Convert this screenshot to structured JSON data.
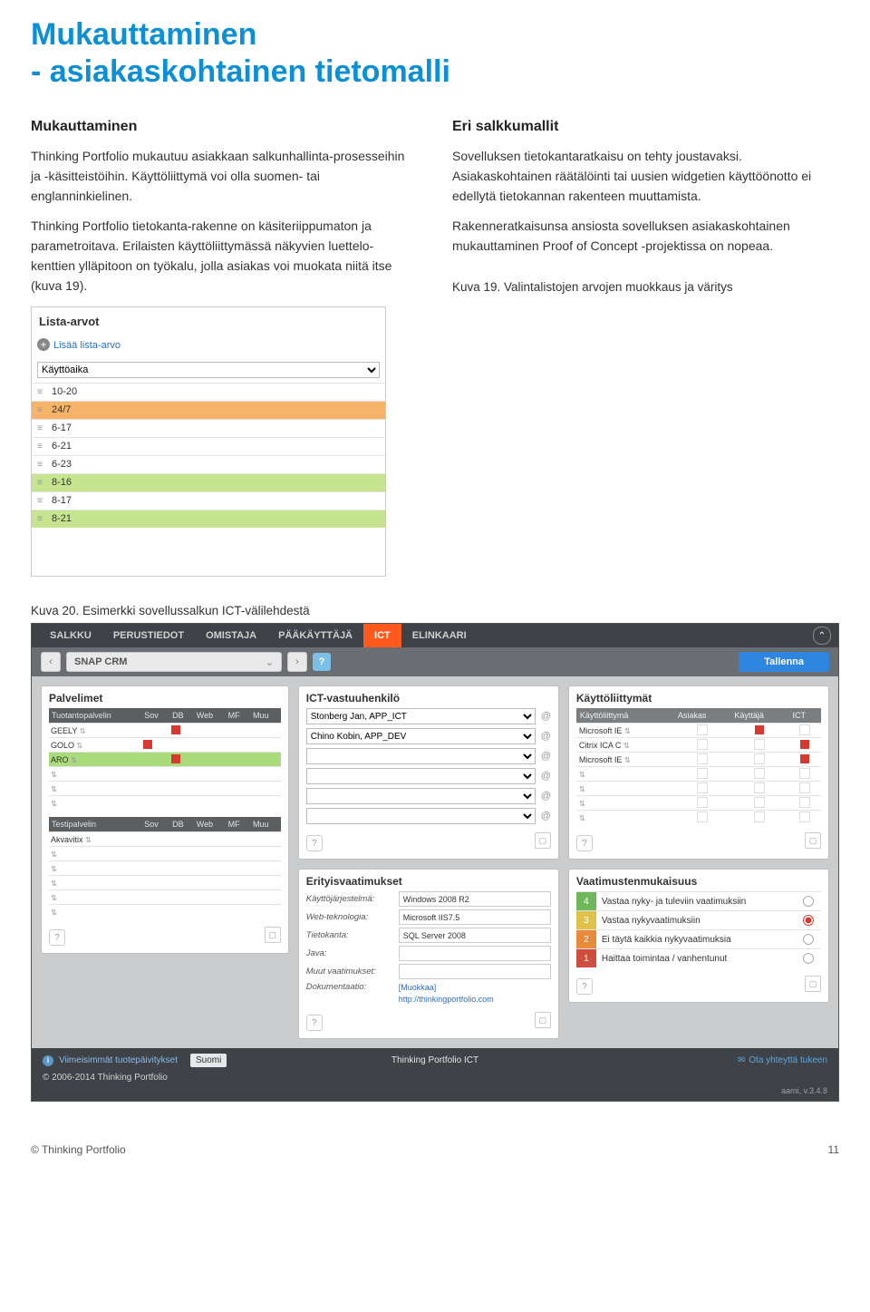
{
  "title": "Mukauttaminen\n- asiakaskohtainen tietomalli",
  "col_left": {
    "heading": "Mukauttaminen",
    "p1": "Thinking Portfolio mukautuu asiakkaan salkunhallinta-prosesseihin ja -käsitteistöihin. Käyttöliittymä voi olla suomen- tai englanninkielinen.",
    "p2": "Thinking Portfolio tietokanta-rakenne on käsiteriippumaton ja parametroitava. Erilaisten käyttöliittymässä näkyvien luettelo-kenttien ylläpitoon on työkalu, jolla asiakas voi muokata niitä itse (kuva 19)."
  },
  "col_right": {
    "heading": "Eri salkkumallit",
    "p1": "Sovelluksen tietokantaratkaisu on tehty joustavaksi. Asiakaskohtainen räätälöinti tai uusien widgetien käyttöönotto ei edellytä tietokannan rakenteen muuttamista.",
    "p2": "Rakenneratkaisunsa ansiosta sovelluksen asiakaskohtainen mukauttaminen Proof of Concept -projektissa on nopeaa.",
    "caption": "Kuva 19. Valintalistojen arvojen muokkaus ja väritys"
  },
  "list_panel": {
    "title": "Lista-arvot",
    "add": "Lisää lista-arvo",
    "select": "Käyttöaika",
    "rows": [
      {
        "v": "10-20",
        "c": ""
      },
      {
        "v": "24/7",
        "c": "hl-orange"
      },
      {
        "v": "6-17",
        "c": ""
      },
      {
        "v": "6-21",
        "c": ""
      },
      {
        "v": "6-23",
        "c": ""
      },
      {
        "v": "8-16",
        "c": "hl-green"
      },
      {
        "v": "8-17",
        "c": ""
      },
      {
        "v": "8-21",
        "c": "hl-green"
      }
    ]
  },
  "caption20": "Kuva 20. Esimerkki sovellussalkun ICT-välilehdestä",
  "app": {
    "tabs": [
      "SALKKU",
      "PERUSTIEDOT",
      "OMISTAJA",
      "PÄÄKÄYTTÄJÄ",
      "ICT",
      "ELINKAARI"
    ],
    "active_tab": 4,
    "crumb": "SNAP CRM",
    "save": "Tallenna",
    "left": {
      "title1": "Palvelimet",
      "t1": {
        "hdr": [
          "Tuotantopalvelin",
          "Sov",
          "DB",
          "Web",
          "MF",
          "Muu"
        ],
        "rows": [
          [
            "GEELY",
            0,
            1,
            0,
            0,
            0
          ],
          [
            "GOLO",
            1,
            0,
            0,
            0,
            0
          ],
          [
            "ARO",
            0,
            1,
            0,
            0,
            0,
            "grn"
          ],
          [
            "",
            0,
            0,
            0,
            0,
            0
          ],
          [
            "",
            0,
            0,
            0,
            0,
            0
          ],
          [
            "",
            0,
            0,
            0,
            0,
            0
          ]
        ]
      },
      "t2": {
        "hdr": [
          "Testipalvelin",
          "Sov",
          "DB",
          "Web",
          "MF",
          "Muu"
        ],
        "rows": [
          [
            "Akvavitix",
            0,
            0,
            0,
            0,
            0
          ],
          [
            "",
            0,
            0,
            0,
            0,
            0
          ],
          [
            "",
            0,
            0,
            0,
            0,
            0
          ],
          [
            "",
            0,
            0,
            0,
            0,
            0
          ],
          [
            "",
            0,
            0,
            0,
            0,
            0
          ],
          [
            "",
            0,
            0,
            0,
            0,
            0
          ]
        ]
      }
    },
    "mid": {
      "resp_title": "ICT-vastuuhenkilö",
      "resp": [
        "Stonberg Jan, APP_ICT",
        "Chino Kobin, APP_DEV",
        "",
        "",
        "",
        ""
      ],
      "req_title": "Erityisvaatimukset",
      "req": [
        {
          "k": "Käyttöjärjestelmä:",
          "v": "Windows 2008 R2"
        },
        {
          "k": "Web-teknologia:",
          "v": "Microsoft IIS7.5"
        },
        {
          "k": "Tietokanta:",
          "v": "SQL Server 2008"
        },
        {
          "k": "Java:",
          "v": ""
        },
        {
          "k": "Muut vaatimukset:",
          "v": ""
        },
        {
          "k": "Dokumentaatio:",
          "v": "[Muokkaa]",
          "link": true
        },
        {
          "k": "",
          "v": "http://thinkingportfolio.com",
          "plain": true
        }
      ]
    },
    "right": {
      "ui_title": "Käyttöliittymät",
      "ui": {
        "hdr": [
          "Käyttöliittymä",
          "Asiakas",
          "Käyttäjä",
          "ICT"
        ],
        "rows": [
          [
            "Microsoft IE",
            0,
            1,
            0
          ],
          [
            "Citrix ICA C",
            0,
            0,
            1
          ],
          [
            "Microsoft IE",
            0,
            0,
            1
          ],
          [
            "",
            0,
            0,
            0
          ],
          [
            "",
            0,
            0,
            0
          ],
          [
            "",
            0,
            0,
            0
          ],
          [
            "",
            0,
            0,
            0
          ]
        ]
      },
      "comp_title": "Vaatimustenmukaisuus",
      "comp": [
        {
          "n": "4",
          "c": "g",
          "t": "Vastaa nyky- ja tuleviin vaatimuksiin",
          "s": 0
        },
        {
          "n": "3",
          "c": "y",
          "t": "Vastaa nykyvaatimuksiin",
          "s": 1
        },
        {
          "n": "2",
          "c": "o",
          "t": "Ei täytä kaikkia nykyvaatimuksia",
          "s": 0
        },
        {
          "n": "1",
          "c": "r",
          "t": "Haittaa toimintaa / vanhentunut",
          "s": 0
        }
      ]
    },
    "footer": {
      "updates": "Viimeisimmät tuotepäivitykset",
      "lang": "Suomi",
      "center": "Thinking Portfolio ICT",
      "support": "Ota yhteyttä tukeen",
      "copyright": "© 2006-2014 Thinking Portfolio",
      "ver": "aami, v.3.4.8"
    }
  },
  "page_footer": {
    "left": "© Thinking Portfolio",
    "right": "11"
  }
}
